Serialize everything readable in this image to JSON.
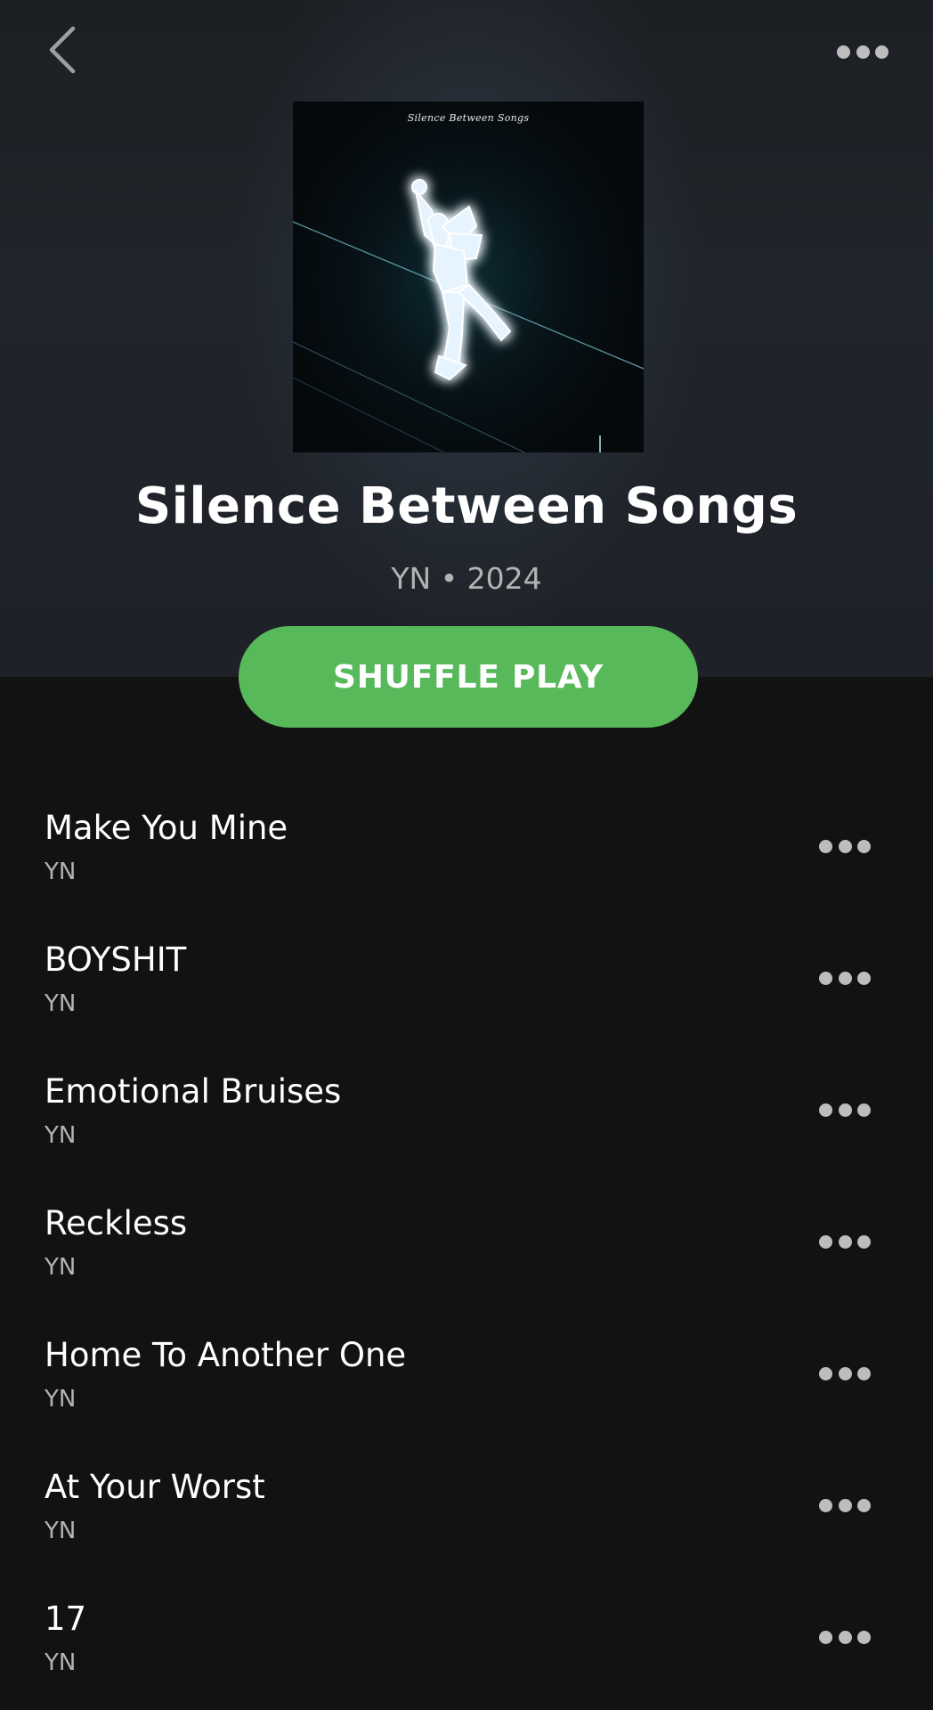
{
  "header": {
    "back_icon": "chevron-left-icon",
    "more_icon": "more-horizontal-icon"
  },
  "album": {
    "cover_text": "Silence Between Songs",
    "title": "Silence Between Songs",
    "meta": "YN • 2024"
  },
  "actions": {
    "shuffle_label": "SHUFFLE PLAY",
    "shuffle_color": "#57b95a"
  },
  "tracks": [
    {
      "title": "Make You Mine",
      "artist": "YN"
    },
    {
      "title": "BOYSHIT",
      "artist": "YN"
    },
    {
      "title": "Emotional Bruises",
      "artist": "YN"
    },
    {
      "title": "Reckless",
      "artist": "YN"
    },
    {
      "title": "Home To Another One",
      "artist": "YN"
    },
    {
      "title": "At Your Worst",
      "artist": "YN"
    },
    {
      "title": "17",
      "artist": "YN"
    }
  ],
  "colors": {
    "background": "#121212",
    "hero_background": "#1e2228",
    "text_primary": "#ffffff",
    "text_secondary": "#b3b3b3"
  }
}
